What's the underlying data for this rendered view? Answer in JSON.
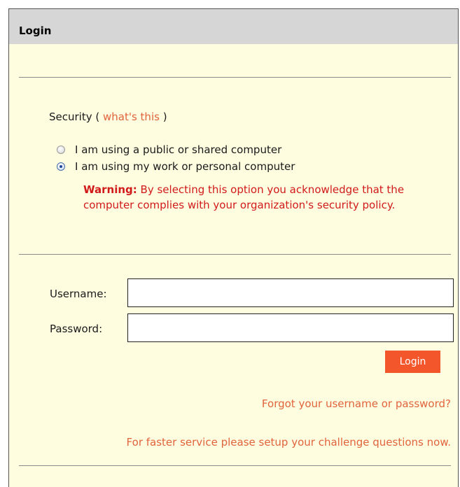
{
  "panel": {
    "title": "Login"
  },
  "security": {
    "label": "Security (",
    "link": "what's this",
    "close": ")",
    "options": [
      {
        "label": "I am using a public or shared computer",
        "checked": false
      },
      {
        "label": "I am using my work or personal computer",
        "checked": true
      }
    ],
    "warning_strong": "Warning:",
    "warning_text": "By selecting this option you acknowledge that the computer complies with your organization's security policy."
  },
  "form": {
    "username_label": "Username:",
    "username_value": "",
    "password_label": "Password:",
    "password_value": "",
    "login_button": "Login"
  },
  "links": {
    "forgot": "Forgot your username or password?",
    "challenge": "For faster service please setup your challenge questions now."
  },
  "colors": {
    "panel_background": "#fffde0",
    "header_background": "#d6d6d6",
    "link": "#e0643c",
    "warning": "#d11a1a",
    "button": "#f3562b"
  }
}
